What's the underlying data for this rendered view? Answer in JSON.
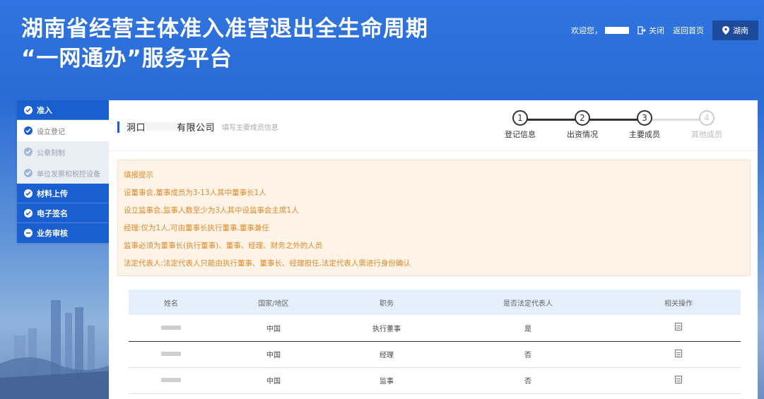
{
  "header": {
    "title_line1": "湖南省经营主体准入准营退出全生命周期",
    "title_line2": "“一网通办”服务平台",
    "welcome": "欢迎您，",
    "close": "关闭",
    "home": "返回首页",
    "region": "湖南"
  },
  "sidebar": {
    "groups": [
      {
        "label": "准入",
        "items": [
          {
            "label": "设立登记",
            "active": true
          },
          {
            "label": "公章刻制"
          },
          {
            "label": "单位发票和税控设备"
          }
        ]
      },
      {
        "label": "材料上传"
      },
      {
        "label": "电子签名"
      },
      {
        "label": "业务审核"
      }
    ]
  },
  "main": {
    "company_prefix": "洞口",
    "company_suffix": "有限公司",
    "hint": "填写主要成员信息",
    "steps": [
      {
        "num": "1",
        "label": "登记信息",
        "done": true
      },
      {
        "num": "2",
        "label": "出资情况",
        "done": true
      },
      {
        "num": "3",
        "label": "主要成员",
        "done": true
      },
      {
        "num": "4",
        "label": "其他成员",
        "done": false
      }
    ]
  },
  "notice": {
    "title": "填报提示",
    "lines": [
      "设董事会,董事成员为3-13人其中董事长1人",
      "设立监事会,监事人数至少为3人其中设监事会主席1人",
      "经理:仅为1人,可由董事长执行董事,董事兼任",
      "监事必须为董事长(执行董事)、董事、经理、财务之外的人员",
      "法定代表人:法定代表人只能由执行董事、董事长、经理担任,法定代表人需进行身份确认"
    ]
  },
  "table": {
    "headers": [
      "姓名",
      "国家/地区",
      "职务",
      "是否法定代表人",
      "相关操作"
    ],
    "rows": [
      {
        "country": "中国",
        "position": "执行董事",
        "legal_rep": "是"
      },
      {
        "country": "中国",
        "position": "经理",
        "legal_rep": "否"
      },
      {
        "country": "中国",
        "position": "监事",
        "legal_rep": "否"
      }
    ]
  },
  "colors": {
    "brand_blue": "#1a5fd0",
    "notice_text": "#e08a2b",
    "notice_bg": "#fdf3e6"
  }
}
